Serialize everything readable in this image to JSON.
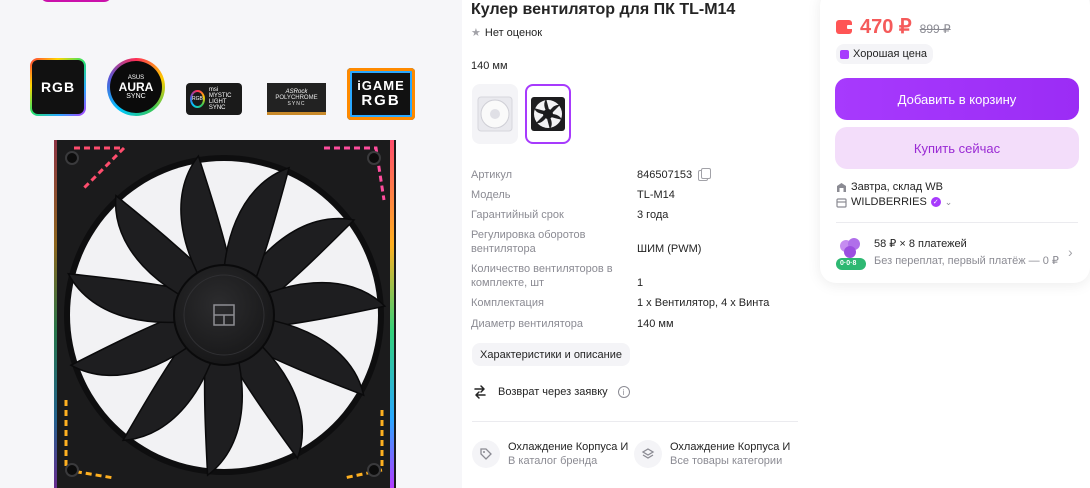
{
  "product": {
    "title": "Кулер вентилятор для ПК TL-M14",
    "rating_text": "Нет оценок",
    "size_label": "140 мм"
  },
  "badges": {
    "rgb": "RGB",
    "aura_top": "ASUS",
    "aura_main": "AURA",
    "aura_sub": "SYNC",
    "msi_ring": "RGB",
    "msi_text": "msi MYSTIC LIGHT SYNC",
    "asrock_brand": "ASRock",
    "asrock_main": "POLYCHROME",
    "asrock_sub": "SYNC",
    "igame_1": "iGAME",
    "igame_2": "RGB"
  },
  "specs": [
    {
      "key": "Артикул",
      "value": "846507153"
    },
    {
      "key": "Модель",
      "value": "TL-M14"
    },
    {
      "key": "Гарантийный срок",
      "value": "3 года"
    },
    {
      "key": "Регулировка оборотов вентилятора",
      "value": "ШИМ (PWM)"
    },
    {
      "key": "Количество вентиляторов в комплекте, шт",
      "value": "1"
    },
    {
      "key": "Комплектация",
      "value": "1 х Вентилятор, 4 х Винта"
    },
    {
      "key": "Диаметр вентилятора",
      "value": "140 мм"
    }
  ],
  "chars_button": "Характеристики и описание",
  "return_text": "Возврат через заявку",
  "categories": [
    {
      "title": "Охлаждение Корпуса И",
      "sub": "В каталог бренда"
    },
    {
      "title": "Охлаждение Корпуса И К",
      "sub": "Все товары категории"
    }
  ],
  "buy": {
    "price": "470 ₽",
    "old_price": "899 ₽",
    "good_price": "Хорошая цена",
    "add_to_cart": "Добавить в корзину",
    "buy_now": "Купить сейчас",
    "delivery": "Завтра, склад WB",
    "seller": "WILDBERRIES",
    "split_title": "58 ₽ × 8 платежей",
    "split_sub": "Без переплат, первый платёж — 0 ₽",
    "split_badge": "0·0·8"
  },
  "colors": {
    "accent": "#a73afd",
    "price": "#f55a5a",
    "buy_now_bg": "#f3ddfa"
  }
}
